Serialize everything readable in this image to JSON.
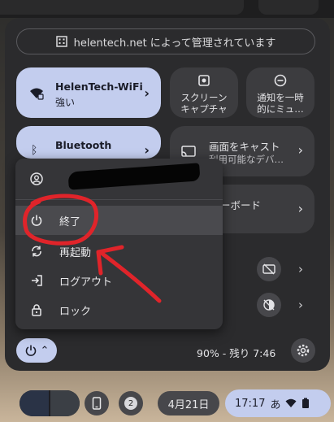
{
  "managed": {
    "text": "helentech.net によって管理されています",
    "icon": "building-icon"
  },
  "tiles": {
    "wifi": {
      "title": "HelenTech-WiFi",
      "subtitle": "強い",
      "icon": "wifi-lock-icon"
    },
    "screen_capture": {
      "line1": "スクリーン",
      "line2": "キャプチャ",
      "icon": "screen-capture-icon"
    },
    "notifications": {
      "line1": "通知を一時",
      "line2": "的にミュ…",
      "icon": "do-not-disturb-icon"
    },
    "bluetooth": {
      "title": "Bluetooth",
      "icon": "bluetooth-icon"
    },
    "cast": {
      "title": "画面をキャスト",
      "subtitle": "利用可能なデバ…",
      "icon": "cast-icon"
    },
    "keyboard": {
      "title": "ーボード"
    }
  },
  "menu": {
    "account_icon": "account-circle-icon",
    "items": [
      {
        "label": "終了",
        "icon": "power-icon"
      },
      {
        "label": "再起動",
        "icon": "restart-icon"
      },
      {
        "label": "ログアウト",
        "icon": "logout-icon"
      },
      {
        "label": "ロック",
        "icon": "lock-icon"
      }
    ]
  },
  "bottom": {
    "battery": "90% - 残り 7:46"
  },
  "shelf": {
    "notification_count": "2",
    "date": "4月21日",
    "time": "17:17",
    "ime": "あ"
  },
  "colors": {
    "accent": "#c3cdee",
    "panel": "#2b2b2d",
    "annotation": "#e0242a"
  }
}
